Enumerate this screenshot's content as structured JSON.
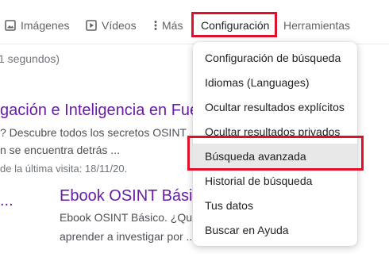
{
  "nav": {
    "images": {
      "label": "Imágenes",
      "icon": "image-icon"
    },
    "videos": {
      "label": "Vídeos",
      "icon": "video-play-icon"
    },
    "more": {
      "label": "Más",
      "icon": "vertical-dots-icon"
    },
    "settings": {
      "label": "Configuración"
    },
    "tools": {
      "label": "Herramientas"
    }
  },
  "results_stats": "1 segundos)",
  "results": [
    {
      "title": "gación e Inteligencia en Fue",
      "snippet_lines": [
        "? Descubre todos los secretos OSINT",
        "n se encuentra detrás ...",
        "de la última visita: 18/11/20."
      ]
    },
    {
      "title": "Ebook OSINT Bási",
      "snippet_lines": [
        "Ebook OSINT Básico. ¿Qu",
        "aprender a investigar por ..."
      ]
    }
  ],
  "menu": {
    "items": [
      {
        "label": "Configuración de búsqueda"
      },
      {
        "label": "Idiomas  (Languages)"
      },
      {
        "label": "Ocultar resultados explícitos"
      },
      {
        "label": "Ocultar resultados privados"
      },
      {
        "label": "Búsqueda avanzada",
        "highlighted": true
      },
      {
        "label": "Historial de búsqueda"
      },
      {
        "label": "Tus datos"
      },
      {
        "label": "Buscar en Ayuda"
      }
    ]
  },
  "colors": {
    "visited_link": "#681da8",
    "annotation_red": "#e0102a",
    "highlight": "#e8e8e8"
  }
}
